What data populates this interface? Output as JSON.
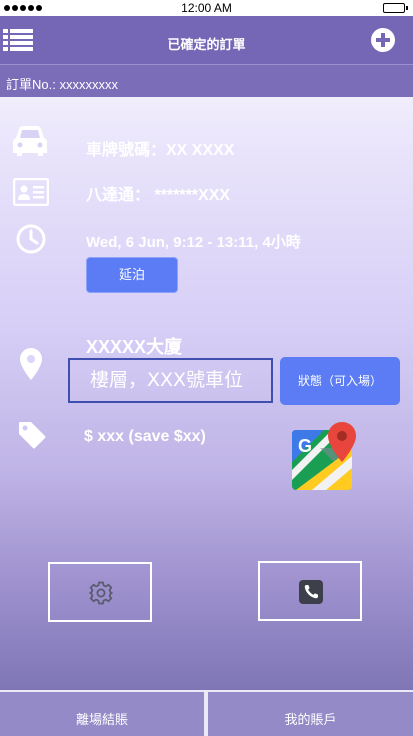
{
  "status_bar": {
    "time": "12:00 AM"
  },
  "header": {
    "title": "已確定的訂單"
  },
  "order": {
    "label": "訂單No.: xxxxxxxxx"
  },
  "vehicle": {
    "plate": "車牌號碼：XX XXXX"
  },
  "octopus": {
    "text": "八達通： *******XXX"
  },
  "time_slot": {
    "text": "Wed, 6 Jun, 9:12 - 13:11, 4小時",
    "extend_label": "延泊"
  },
  "location": {
    "building": "XXXXX大廈",
    "floor_placeholder": "樓層，XXX號車位",
    "status_label": "狀態（可入場）"
  },
  "price": {
    "text": "$ xxx (save $xx)"
  },
  "icons": {
    "menu": "list-menu-icon",
    "add": "plus-circle-icon",
    "car": "car-icon",
    "card": "id-card-icon",
    "clock": "clock-icon",
    "location": "location-pin-icon",
    "tag": "price-tag-icon",
    "maps": "google-maps-icon",
    "settings": "gear-icon",
    "phone": "phone-icon"
  },
  "bottom_nav": {
    "checkout": "離場結賬",
    "account": "我的賬戶"
  },
  "colors": {
    "header": "#7567b5",
    "accent_button": "#5b7cf4"
  }
}
